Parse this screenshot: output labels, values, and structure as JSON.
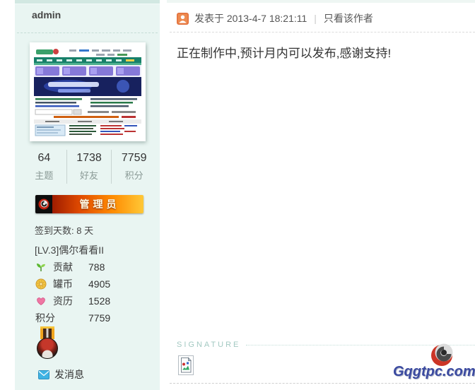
{
  "sidebar": {
    "username": "admin",
    "stats_row": [
      {
        "value": "64",
        "label": "主题"
      },
      {
        "value": "1738",
        "label": "好友"
      },
      {
        "value": "7759",
        "label": "积分"
      }
    ],
    "group_badge": "管理员",
    "signin_days": "签到天数: 8 天",
    "level_title": "[LV.3]偶尔看看II",
    "credits": [
      {
        "icon": "sprout-icon",
        "label": "贡献",
        "value": "788"
      },
      {
        "icon": "coin-icon",
        "label": "罐币",
        "value": "4905"
      },
      {
        "icon": "heart-icon",
        "label": "资历",
        "value": "1528"
      },
      {
        "icon": "none",
        "label": "积分",
        "value": "7759"
      }
    ],
    "send_message_label": "发消息"
  },
  "post": {
    "posted_at_label": "发表于 2013-4-7 18:21:11",
    "divider": "|",
    "only_author_label": "只看该作者",
    "content": "正在制作中,预计月内可以发布,感谢支持!",
    "signature_label": "SIGNATURE"
  },
  "watermark": {
    "text": "Gqgtpc.com"
  },
  "icons": [
    "author-person-icon",
    "sprout-icon",
    "coin-icon",
    "heart-icon",
    "envelope-icon",
    "medal-icon",
    "broken-image-icon",
    "gqgtpc-logo-icon",
    "admin-badge-logo-icon"
  ],
  "colors": {
    "sidebar_bg": "#e9f5f2",
    "accent_orange": "#e2703c",
    "badge_gradient": "#9e1c00 → #ffc837",
    "signature_teal": "#a3c9c2",
    "watermark_blue": "#3b4aa0",
    "envelope_blue": "#3fb3e3"
  }
}
